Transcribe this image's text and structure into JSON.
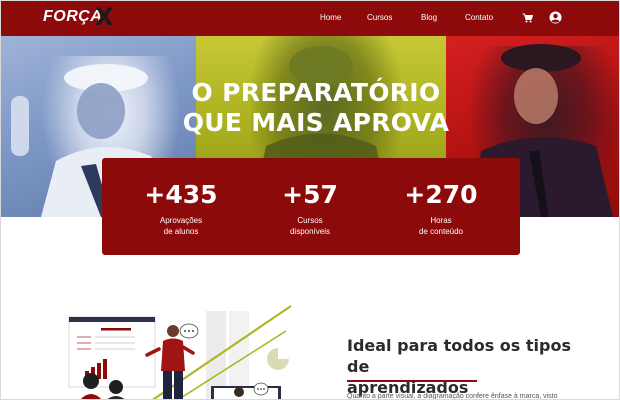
{
  "brand": {
    "name": "FORÇA",
    "mark": "X"
  },
  "nav": {
    "items": [
      {
        "label": "Home"
      },
      {
        "label": "Cursos"
      },
      {
        "label": "Blog"
      },
      {
        "label": "Contato"
      }
    ],
    "cart_icon": "cart-icon",
    "user_icon": "user-circle-icon"
  },
  "hero": {
    "title_line1": "O PREPARATÓRIO",
    "title_line2": "QUE MAIS APROVA"
  },
  "stats": [
    {
      "value": "+435",
      "label_line1": "Aprovações",
      "label_line2": "de alunos"
    },
    {
      "value": "+57",
      "label_line1": "Cursos",
      "label_line2": "disponíveis"
    },
    {
      "value": "+270",
      "label_line1": "Horas",
      "label_line2": "de conteúdo"
    }
  ],
  "section": {
    "title_line1": "Ideal para todos os tipos de",
    "title_line2": "aprendizados",
    "body": "Quanto a parte visual, a diagramação confere ênfase à marca, visto"
  },
  "colors": {
    "brand": "#8d0a0a",
    "text_dark": "#2b2b2b",
    "accent_olive": "#b0b523"
  }
}
